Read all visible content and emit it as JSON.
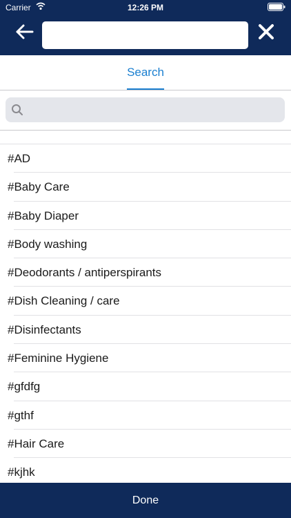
{
  "status_bar": {
    "carrier": "Carrier",
    "time": "12:26 PM"
  },
  "nav": {
    "search_value": "",
    "back_icon": "arrow-left-icon",
    "close_icon": "close-icon"
  },
  "tabs": [
    {
      "label": "Search",
      "active": true
    }
  ],
  "search": {
    "placeholder": "",
    "icon": "search-icon"
  },
  "list": {
    "items": [
      "#AD",
      "#Baby Care",
      "#Baby Diaper",
      "#Body washing",
      "#Deodorants / antiperspirants",
      "#Dish Cleaning / care",
      "#Disinfectants",
      "#Feminine Hygiene",
      "#gfdfg",
      "#gthf",
      "#Hair Care",
      "#kjhk"
    ]
  },
  "footer": {
    "done_label": "Done"
  },
  "colors": {
    "nav_bg": "#0f2a5a",
    "accent": "#1a7fd0"
  }
}
